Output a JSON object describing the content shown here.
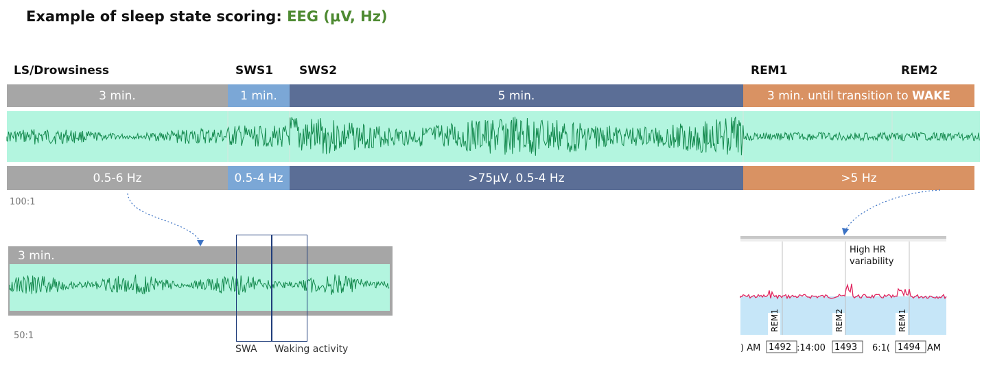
{
  "title": {
    "main": "Example of sleep state scoring:",
    "accent": "EEG (μV, Hz)"
  },
  "stages": {
    "ls": "LS/Drowsiness",
    "sws1": "SWS1",
    "sws2": "SWS2",
    "rem1": "REM1",
    "rem2": "REM2"
  },
  "durations": {
    "ls": "3 min.",
    "sws1": "1 min.",
    "sws2": "5 min.",
    "rem_prefix": "3 min. until transition to",
    "rem_wake": "WAKE"
  },
  "frequencies": {
    "ls": "0.5-6 Hz",
    "sws1": "0.5-4 Hz",
    "sws2": ">75μV, 0.5-4 Hz",
    "rem": ">5 Hz"
  },
  "scale_main": "100:1",
  "zoom_left": {
    "duration": "3 min.",
    "scale": "50:1",
    "swa_label": "SWA",
    "waking_label": "Waking activity"
  },
  "hr_panel": {
    "annotation_line1": "High HR",
    "annotation_line2": "variability",
    "markers": [
      "REM1",
      "REM2",
      "REM1"
    ],
    "axis_time_1": ") AM",
    "axis_time_2": ":14:00",
    "axis_time_3": "6:1(",
    "axis_time_4": "AM",
    "epochs": [
      "1492",
      "1493",
      "1494"
    ]
  },
  "colors": {
    "ls": "#a6a6a6",
    "sws1": "#7ba7d6",
    "sws2": "#5b6e96",
    "rem": "#d99263",
    "eeg_bg": "#b3f5df",
    "eeg_trace": "#13894d",
    "hr_trace": "#e0245e",
    "hr_fill": "#c6e6f8",
    "title_accent": "#4e8a32"
  }
}
